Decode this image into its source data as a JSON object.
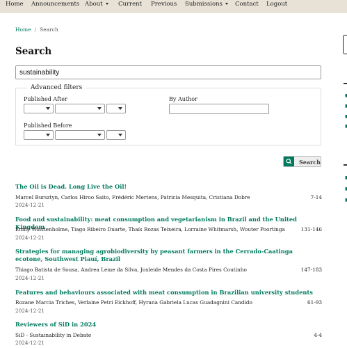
{
  "nav": {
    "home": "Home",
    "announcements": "Announcements",
    "about": "About",
    "current": "Current",
    "previous": "Previous",
    "submissions": "Submissions",
    "contact": "Contact",
    "logout": "Logout"
  },
  "breadcrumb": {
    "home": "Home",
    "separator": "/",
    "current": "Search"
  },
  "page_title": "Search",
  "search": {
    "query": "sustainability"
  },
  "filters": {
    "legend": "Advanced filters",
    "published_after": "Published After",
    "published_before": "Published Before",
    "by_author": "By Author"
  },
  "search_button": "Search",
  "results": [
    {
      "title": "The Oil is Dead. Long Live the Oil!",
      "authors": "Marcel Bursztyn, Carlos Hiroo Saito, Frédéric Mertens, Patricia Mesquita, Cristiana Dobre",
      "pages": "7-14",
      "date": "2024-12-21"
    },
    {
      "title": "Food and sustainability: meat consumption and vegetarianism in Brazil and the United Kingdom",
      "authors": "Emily Wolstenholme, Tiago Ribeiro Duarte, Thaís Rozas Teixeira, Lorraine Whitmarsh, Wouter Poortinga",
      "pages": "131-146",
      "date": "2024-12-21"
    },
    {
      "title": "Strategies for managing agrobiodiversity by peasant farmers in the Cerrado-Caatinga ecotone, Southwest Piauí, Brazil",
      "authors": "Thiago Batista de Sousa, Andrea Leme da Silva, Joxleide Mendes da Costa Pires Coutinho",
      "pages": "147-183",
      "date": "2024-12-21"
    },
    {
      "title": "Features and behaviours associated with meat consumption in Brazilian university students",
      "authors": "Rozane Marcia Triches, Verlaine Petri Eickhoff, Hyrana Gabriela Lucas Guadagnini Candido",
      "pages": "61-93",
      "date": "2024-12-21"
    },
    {
      "title": "Reviewers of SiD in 2024",
      "authors": "SiD - Sustainability in Debate",
      "pages": "4-4",
      "date": "2024-12-21"
    }
  ],
  "colors": {
    "accent": "#007a5e",
    "nav_bg": "#e8e2d6"
  }
}
